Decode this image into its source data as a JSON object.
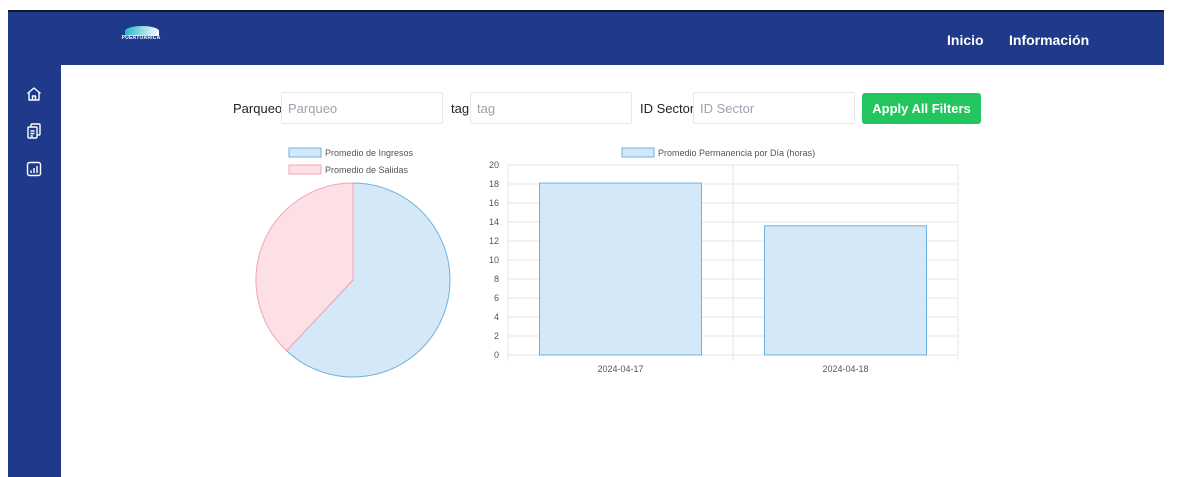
{
  "topbar": {
    "logo_text": "PUERTOARICA",
    "nav": [
      "Inicio",
      "Información"
    ]
  },
  "sidebar": {
    "items": [
      {
        "icon": "home-icon"
      },
      {
        "icon": "clipboard-icon"
      },
      {
        "icon": "chart-icon"
      }
    ]
  },
  "filters": {
    "parqueo_label": "Parqueo",
    "parqueo_placeholder": "Parqueo",
    "tag_label": "tag:",
    "tag_placeholder": "tag",
    "sector_label": "ID Sector:",
    "sector_placeholder": "ID Sector",
    "apply_label": "Apply All Filters"
  },
  "colors": {
    "nav_bg": "#1f3a8a",
    "apply_bg": "#22c55e",
    "blue_fill": "#d4e8f7",
    "blue_stroke": "#6cb3e4",
    "pink_fill": "#fde0e6",
    "pink_stroke": "#f4a3b5"
  },
  "chart_data": [
    {
      "type": "pie",
      "labels": [
        "Promedio de Ingresos",
        "Promedio de Salidas"
      ],
      "values": [
        62,
        38
      ],
      "legend": "top"
    },
    {
      "type": "bar",
      "categories": [
        "2024-04-17",
        "2024-04-18"
      ],
      "series": [
        {
          "name": "Promedio Permanencia por Día (horas)",
          "values": [
            18.1,
            13.6
          ]
        }
      ],
      "ylim": [
        0,
        20
      ],
      "yticks": [
        "0",
        "2",
        "4",
        "6",
        "8",
        "10",
        "12",
        "14",
        "16",
        "18",
        "20"
      ],
      "grid": true,
      "legend": "top"
    }
  ]
}
